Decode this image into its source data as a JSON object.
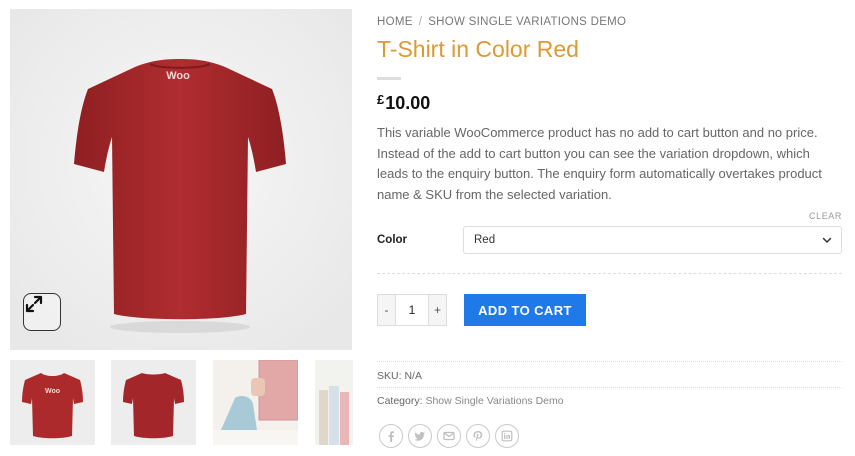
{
  "gallery": {
    "main_logo_text": "Woo",
    "thumb_logo_text": "Woo",
    "shirt_color": "#a8282b",
    "zoom_icon": "expand-icon"
  },
  "breadcrumb": {
    "home": "HOME",
    "separator": "/",
    "current": "SHOW SINGLE VARIATIONS DEMO"
  },
  "product": {
    "title": "T-Shirt in Color Red",
    "currency": "£",
    "price": "10.00",
    "description": "This variable WooCommerce product has no add to cart button and no price. Instead of the add to cart button you can see the variation dropdown, which leads to the enquiry button. The enquiry form automatically overtakes product name & SKU from the selected variation."
  },
  "variation": {
    "clear_label": "CLEAR",
    "color_label": "Color",
    "color_selected": "Red"
  },
  "cart": {
    "minus_label": "-",
    "quantity": "1",
    "plus_label": "+",
    "add_to_cart_label": "ADD TO CART"
  },
  "meta": {
    "sku_label": "SKU:",
    "sku_value": "N/A",
    "category_label": "Category:",
    "category_value": "Show Single Variations Demo"
  },
  "share": [
    "facebook-icon",
    "twitter-icon",
    "email-icon",
    "pinterest-icon",
    "linkedin-icon"
  ],
  "colors": {
    "accent_title": "#dd9933",
    "button_blue": "#2079e8"
  }
}
